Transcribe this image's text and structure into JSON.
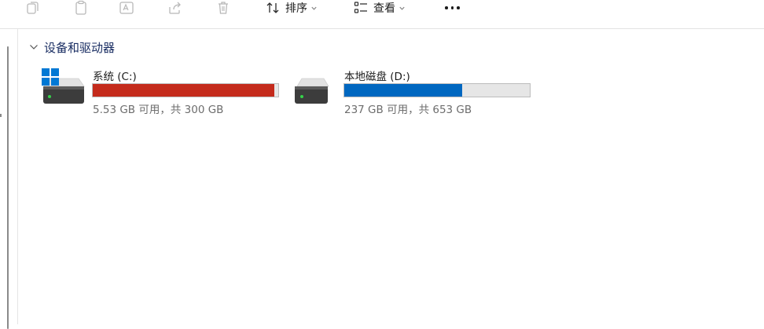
{
  "toolbar": {
    "sort_label": "排序",
    "view_label": "查看"
  },
  "group": {
    "title": "设备和驱动器"
  },
  "drives": [
    {
      "name": "系统 (C:)",
      "free_text": "5.53 GB 可用，共 300 GB",
      "used_fraction": 0.98,
      "bar_color": "#c42b1c"
    },
    {
      "name": "本地磁盘 (D:)",
      "free_text": "237 GB 可用，共 653 GB",
      "used_fraction": 0.637,
      "bar_color": "#0067c0"
    }
  ],
  "colors": {
    "accent": "#0067c0",
    "critical": "#c42b1c",
    "group_header": "#1a2e63"
  }
}
